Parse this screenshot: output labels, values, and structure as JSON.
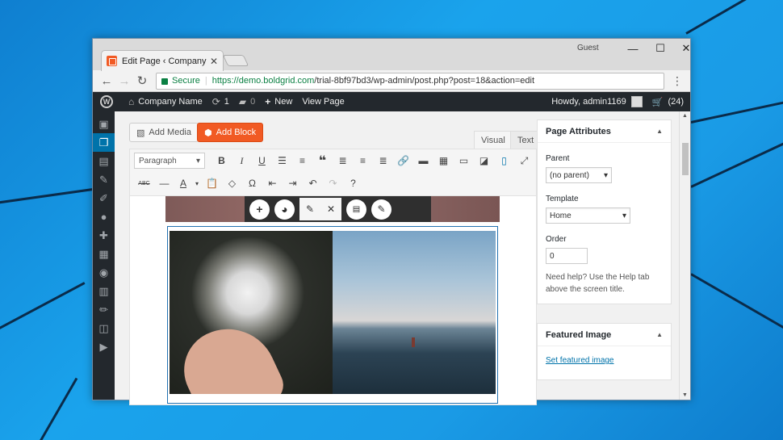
{
  "browser": {
    "tab_title": "Edit Page ‹ Company Nam",
    "profile_label": "Guest",
    "secure_label": "Secure",
    "url_host": "https://demo.boldgrid.com",
    "url_path": "/trial-8bf97bd3/wp-admin/post.php?post=18&action=edit"
  },
  "adminbar": {
    "site_name": "Company Name",
    "updates_count": "1",
    "comments_count": "0",
    "new_label": "New",
    "view_label": "View Page",
    "howdy": "Howdy, admin1169",
    "cart_count": "(24)"
  },
  "editor": {
    "add_media_label": "Add Media",
    "add_block_label": "Add Block",
    "tab_visual": "Visual",
    "tab_text": "Text",
    "format_value": "Paragraph"
  },
  "page_attributes": {
    "title": "Page Attributes",
    "parent_label": "Parent",
    "parent_value": "(no parent)",
    "template_label": "Template",
    "template_value": "Home",
    "order_label": "Order",
    "order_value": "0",
    "help_text": "Need help? Use the Help tab above the screen title."
  },
  "featured_image": {
    "title": "Featured Image",
    "link_label": "Set featured image"
  },
  "colors": {
    "accent_orange": "#f15a24",
    "wp_blue": "#0073aa",
    "admin_dark": "#23282d"
  }
}
